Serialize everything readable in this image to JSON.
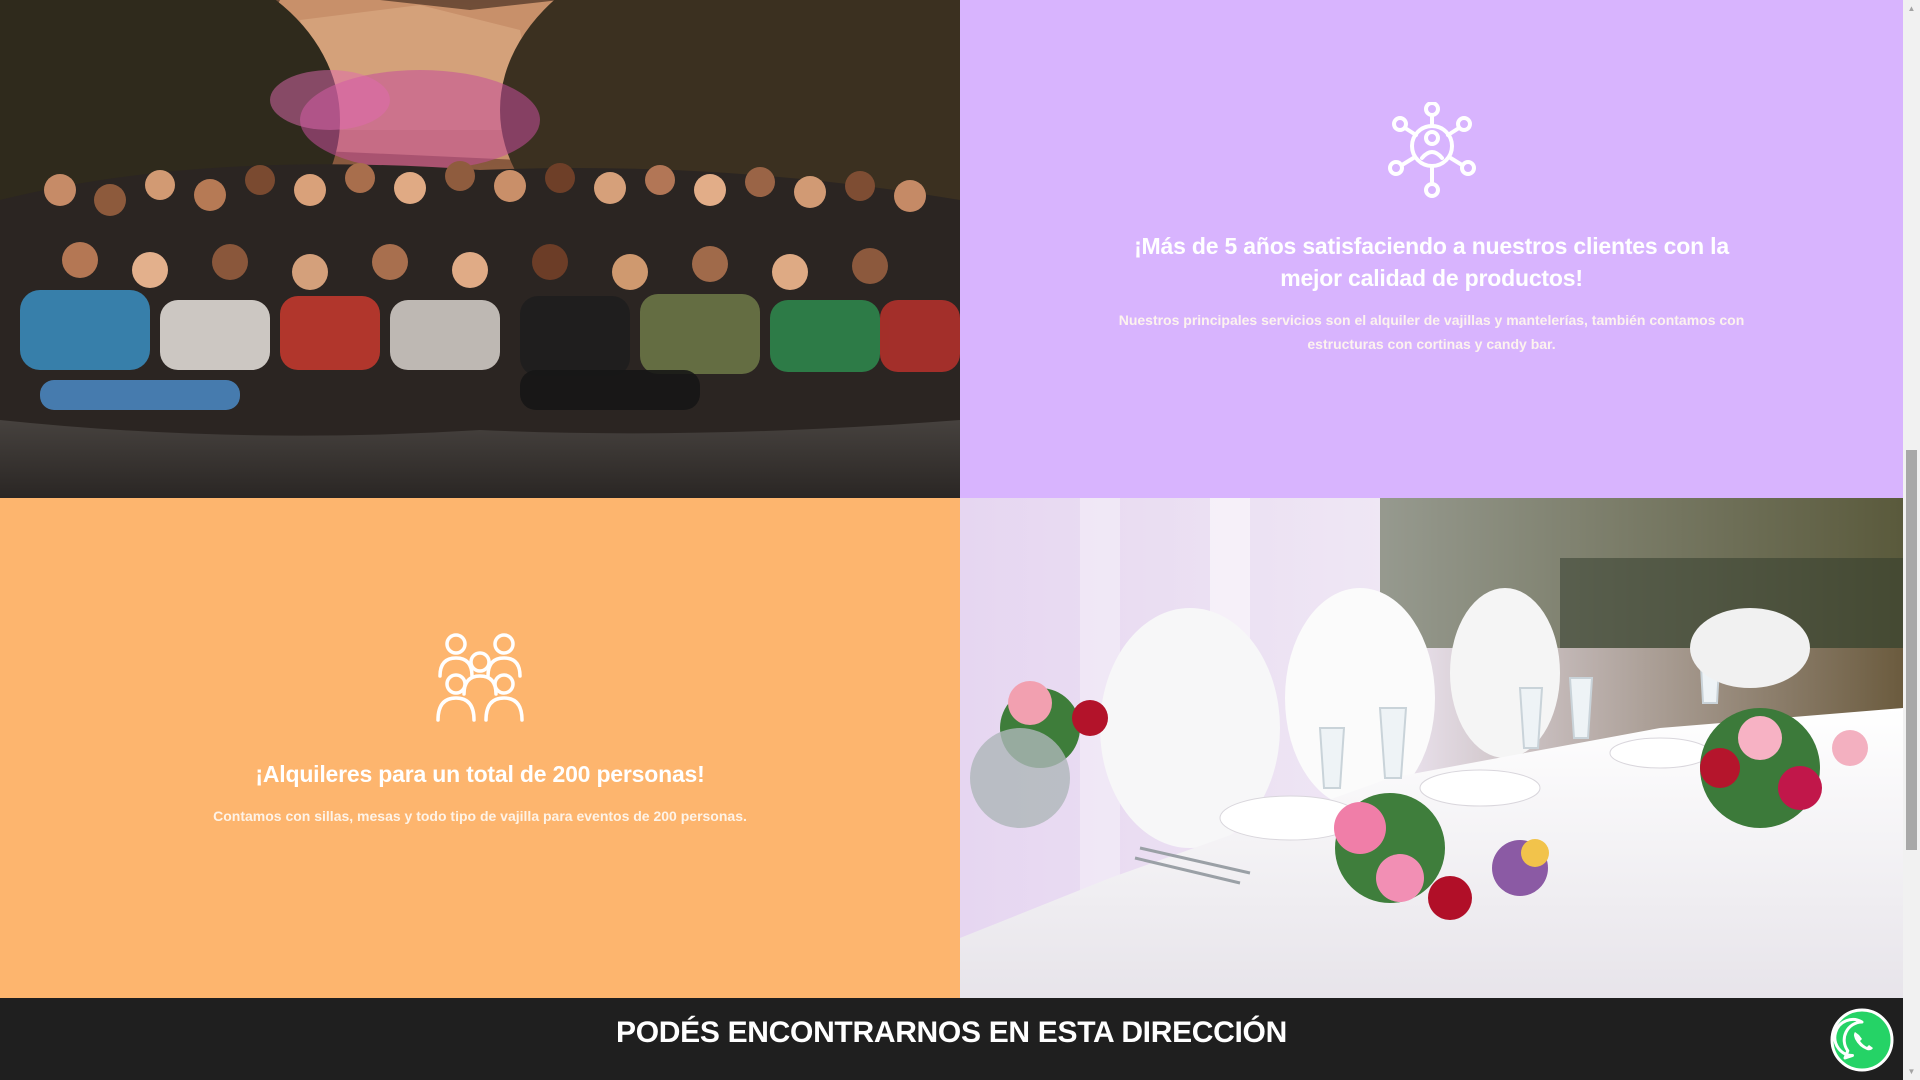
{
  "feature_experience": {
    "icon": "network-people-icon",
    "title": "¡Más de 5 años satisfaciendo a nuestros clientes con la mejor calidad de productos!",
    "text": "Nuestros principales servicios son el alquiler de vajillas y mantelerías, también contamos con estructuras con cortinas y candy bar.",
    "background": "#d8b4fe"
  },
  "feature_capacity": {
    "icon": "group-people-icon",
    "title": "¡Alquileres para un total de 200 personas!",
    "text": "Contamos con sillas, mesas y todo tipo de vajilla para eventos de 200 personas.",
    "background": "#fdb56e"
  },
  "images": {
    "crowd_photo": "crowd-photo",
    "table_photo": "banquet-table-photo"
  },
  "footer_band": {
    "title": "PODÉS ENCONTRARNOS EN ESTA DIRECCIÓN"
  },
  "whatsapp": {
    "icon": "whatsapp-icon",
    "color": "#25d366"
  }
}
